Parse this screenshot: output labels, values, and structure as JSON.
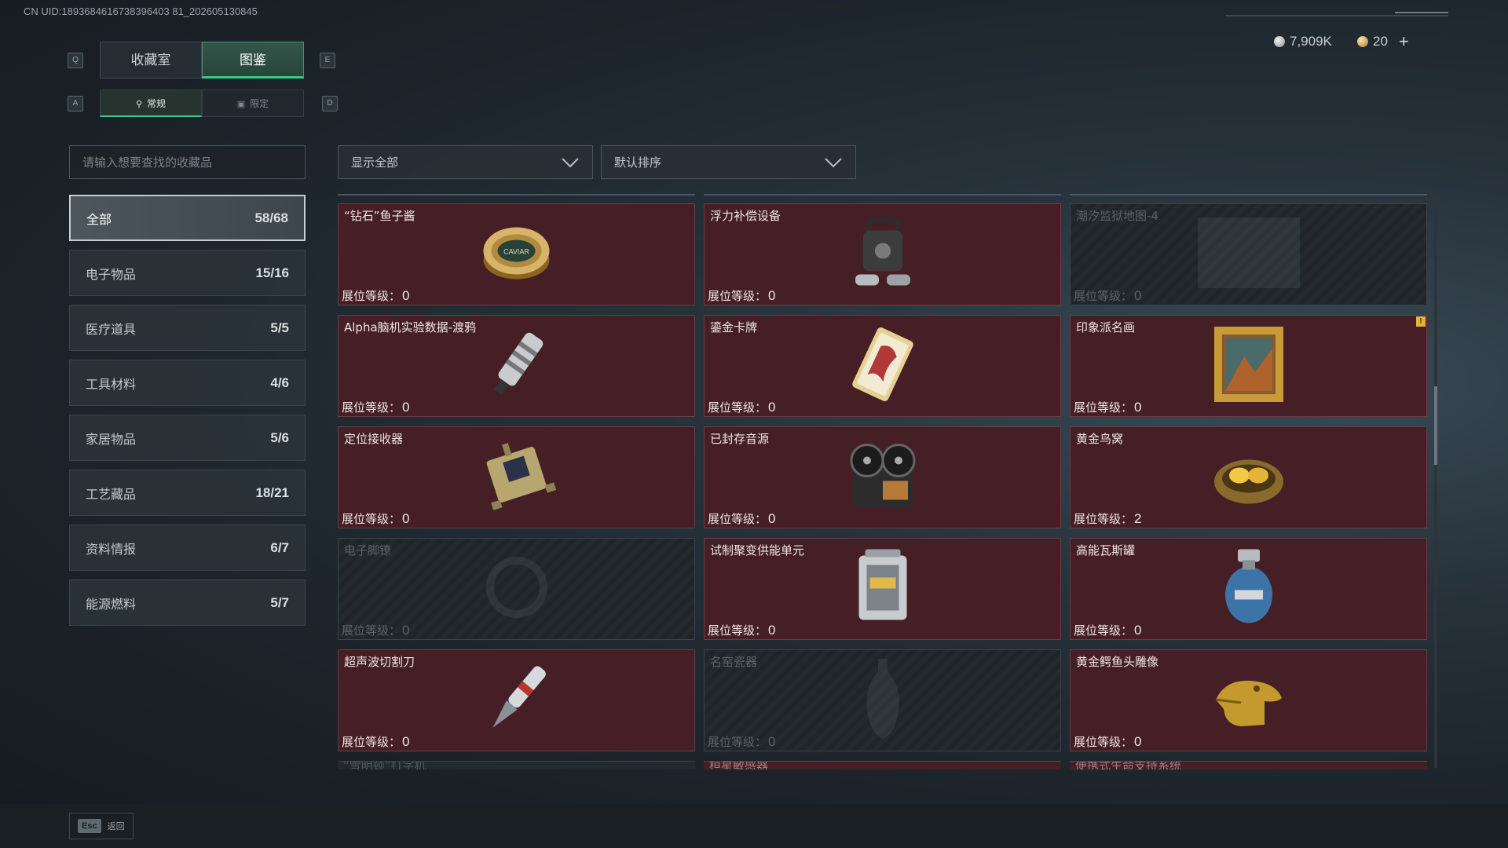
{
  "uid_text": "CN UID:1893684616738396403 81_202605130845",
  "currency": {
    "silver_value": "7,909K",
    "gold_value": "20",
    "plus_label": "+"
  },
  "keys": {
    "prev_tab": "Q",
    "next_tab": "E",
    "prev_sub": "A",
    "next_sub": "D"
  },
  "tabs": [
    {
      "label": "收藏室",
      "active": false
    },
    {
      "label": "图鉴",
      "active": true
    }
  ],
  "subtabs": [
    {
      "icon": "flask-icon",
      "label": "常规",
      "active": true
    },
    {
      "icon": "image-icon",
      "label": "限定",
      "active": false
    }
  ],
  "search": {
    "placeholder": "请输入想要查找的收藏品",
    "value": ""
  },
  "categories": [
    {
      "label": "全部",
      "count": "58/68",
      "active": true
    },
    {
      "label": "电子物品",
      "count": "15/16"
    },
    {
      "label": "医疗道具",
      "count": "5/5"
    },
    {
      "label": "工具材料",
      "count": "4/6"
    },
    {
      "label": "家居物品",
      "count": "5/6"
    },
    {
      "label": "工艺藏品",
      "count": "18/21"
    },
    {
      "label": "资料情报",
      "count": "6/7"
    },
    {
      "label": "能源燃料",
      "count": "5/7"
    }
  ],
  "filters": {
    "display": "显示全部",
    "sort": "默认排序"
  },
  "level_label": "展位等级：",
  "items": [
    {
      "name": "“钻石”鱼子酱",
      "level": "0",
      "locked": false,
      "icon": "caviar-tin-icon"
    },
    {
      "name": "浮力补偿设备",
      "level": "0",
      "locked": false,
      "icon": "buoyancy-device-icon"
    },
    {
      "name": "潮汐监狱地图-4",
      "level": "0",
      "locked": true,
      "icon": "map-icon"
    },
    {
      "name": "Alpha脑机实验数据-渡鸦",
      "level": "0",
      "locked": false,
      "icon": "data-drive-icon"
    },
    {
      "name": "鎏金卡牌",
      "level": "0",
      "locked": false,
      "icon": "gold-card-icon"
    },
    {
      "name": "印象派名画",
      "level": "0",
      "locked": false,
      "icon": "painting-icon",
      "flag": "!"
    },
    {
      "name": "定位接收器",
      "level": "0",
      "locked": false,
      "icon": "receiver-icon"
    },
    {
      "name": "已封存音源",
      "level": "0",
      "locked": false,
      "icon": "reel-recorder-icon"
    },
    {
      "name": "黄金鸟窝",
      "level": "2",
      "locked": false,
      "icon": "golden-nest-icon"
    },
    {
      "name": "电子脚镣",
      "level": "0",
      "locked": true,
      "icon": "ankle-monitor-icon"
    },
    {
      "name": "试制聚变供能单元",
      "level": "0",
      "locked": false,
      "icon": "fusion-cell-icon"
    },
    {
      "name": "高能瓦斯罐",
      "level": "0",
      "locked": false,
      "icon": "gas-canister-icon"
    },
    {
      "name": "超声波切割刀",
      "level": "0",
      "locked": false,
      "icon": "ultrasonic-knife-icon"
    },
    {
      "name": "名窑瓷器",
      "level": "0",
      "locked": true,
      "icon": "porcelain-vase-icon"
    },
    {
      "name": "黄金鳄鱼头雕像",
      "level": "0",
      "locked": false,
      "icon": "gold-crocodile-icon"
    }
  ],
  "partial_items": [
    {
      "name": "“雪明顿”打字机",
      "locked": true
    },
    {
      "name": "桓星敏感器",
      "locked": false
    },
    {
      "name": "便携式生命支持系统",
      "locked": false
    }
  ],
  "footer": {
    "esc_key": "Esc",
    "back_label": "返回"
  }
}
